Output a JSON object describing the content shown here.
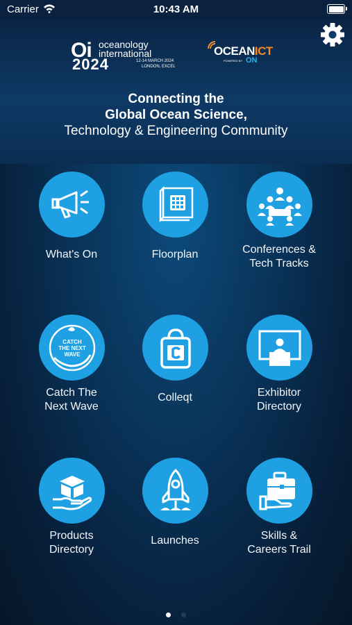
{
  "status_bar": {
    "carrier": "Carrier",
    "time": "10:43 AM",
    "battery_level_percent": 100
  },
  "header": {
    "oi_logo": {
      "mark": "Oi",
      "name_line1": "oceanology",
      "name_line2": "international",
      "year": "2024",
      "dates": "12-14 MARCH 2024",
      "location": "LONDON, EXCEL"
    },
    "ict_logo": {
      "ocean": "OCEAN",
      "ict": "ICT",
      "powered_by": "POWERED BY",
      "on": "ON"
    },
    "tagline_line1": "Connecting the",
    "tagline_line2": "Global Ocean Science,",
    "tagline_line3": "Technology & Engineering Community",
    "settings_icon": "gear-icon"
  },
  "grid": {
    "tiles": [
      {
        "line1": "What's On",
        "line2": "",
        "icon": "megaphone-icon"
      },
      {
        "line1": "Floorplan",
        "line2": "",
        "icon": "floorplan-icon"
      },
      {
        "line1": "Conferences &",
        "line2": "Tech Tracks",
        "icon": "conference-icon"
      },
      {
        "line1": "Catch The",
        "line2": "Next Wave",
        "icon": "catch-next-wave-icon",
        "badge_text": "CATCH THE NEXT WAVE"
      },
      {
        "line1": "Colleqt",
        "line2": "",
        "icon": "colleqt-icon"
      },
      {
        "line1": "Exhibitor",
        "line2": "Directory",
        "icon": "exhibitor-icon"
      },
      {
        "line1": "Products",
        "line2": "Directory",
        "icon": "products-icon"
      },
      {
        "line1": "Launches",
        "line2": "",
        "icon": "rocket-icon"
      },
      {
        "line1": "Skills &",
        "line2": "Careers Trail",
        "icon": "briefcase-icon"
      }
    ]
  },
  "pagination": {
    "pages": 2,
    "current": 1
  },
  "colors": {
    "accent": "#1ea0e2",
    "background": "#0a365d",
    "ict_orange": "#f28c28",
    "on_blue": "#1fb5ef"
  }
}
